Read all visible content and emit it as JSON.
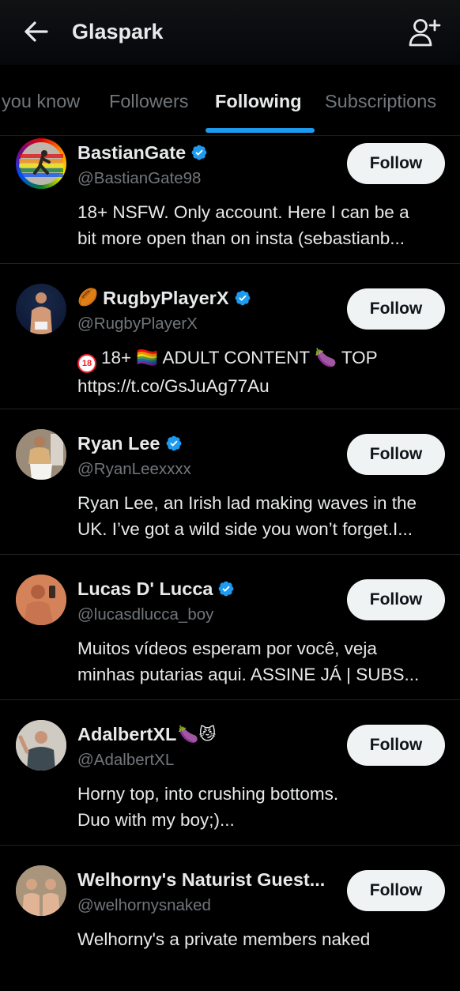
{
  "header": {
    "title": "Glaspark",
    "back_icon": "arrow-left-icon",
    "add_icon": "person-add-icon"
  },
  "tabs": [
    {
      "label": "you know"
    },
    {
      "label": "Followers"
    },
    {
      "label": "Following",
      "active": true
    },
    {
      "label": "Subscriptions"
    }
  ],
  "colors": {
    "accent": "#1d9bf0",
    "verified": "#1d9bf0",
    "button_bg": "#eff3f4",
    "muted": "#71767b",
    "background": "#000000"
  },
  "users": [
    {
      "name": "BastianGate",
      "name_prefix_emoji": "",
      "name_suffix_emoji": "",
      "verified": true,
      "handle": "@BastianGate98",
      "bio_lines": [
        "18+ NSFW. Only account. Here I can be a",
        "bit more open than on insta (sebastianb..."
      ],
      "follow_label": "Follow"
    },
    {
      "name": "RugbyPlayerX",
      "name_prefix_emoji": "🏉",
      "name_suffix_emoji": "",
      "verified": true,
      "handle": "@RugbyPlayerX",
      "bio_lines": [
        "18+ 🏳️‍🌈 ADULT CONTENT 🍆 TOP",
        "https://t.co/GsJuAg77Au"
      ],
      "bio_badge": "18",
      "follow_label": "Follow"
    },
    {
      "name": "Ryan Lee",
      "name_prefix_emoji": "",
      "name_suffix_emoji": "",
      "verified": true,
      "handle": "@RyanLeexxxx",
      "bio_lines": [
        "Ryan Lee, an Irish lad making waves in the",
        "UK. I’ve got a wild side you won’t forget.I..."
      ],
      "follow_label": "Follow"
    },
    {
      "name": "Lucas D' Lucca",
      "name_prefix_emoji": "",
      "name_suffix_emoji": "",
      "verified": true,
      "handle": "@lucasdlucca_boy",
      "bio_lines": [
        "Muitos vídeos esperam por você, veja",
        "minhas putarias aqui. ASSINE JÁ | SUBS..."
      ],
      "follow_label": "Follow"
    },
    {
      "name": "AdalbertXL",
      "name_prefix_emoji": "",
      "name_suffix_emoji": "🍆😼",
      "verified": false,
      "handle": "@AdalbertXL",
      "bio_lines": [
        "Horny top, into crushing bottoms.",
        "Duo with my boy;)..."
      ],
      "follow_label": "Follow"
    },
    {
      "name": "Welhorny's Naturist Guest...",
      "name_prefix_emoji": "",
      "name_suffix_emoji": "",
      "verified": false,
      "handle": "@welhornysnaked",
      "bio_lines": [
        "Welhorny's a private members naked",
        ""
      ],
      "follow_label": "Follow"
    }
  ]
}
